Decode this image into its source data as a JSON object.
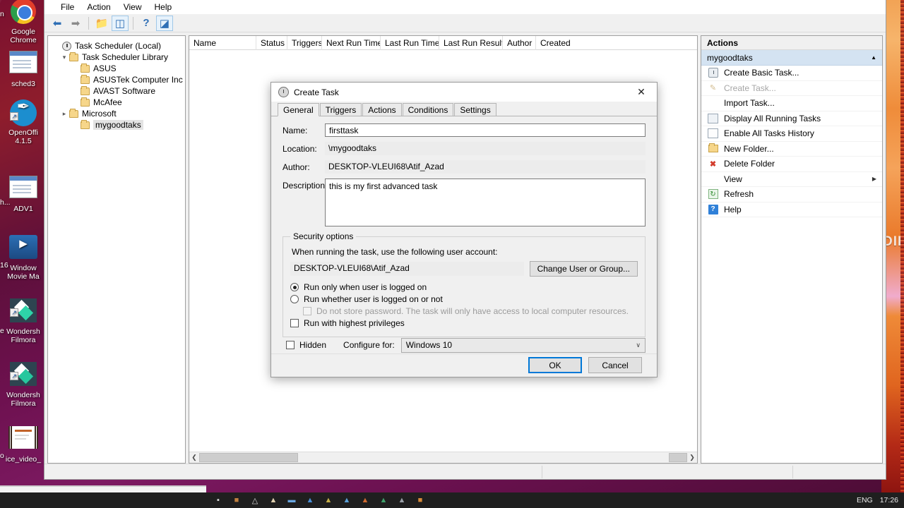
{
  "desktop": {
    "icons": [
      {
        "name": "Google\nChrome",
        "kind": "chrome"
      },
      {
        "name": "sched3",
        "kind": "window"
      },
      {
        "name": "OpenOffi\n4.1.5",
        "kind": "openoffice"
      },
      {
        "name": "ADV1",
        "kind": "window"
      },
      {
        "name": "Window\nMovie Ma",
        "kind": "moviemaker"
      },
      {
        "name": "Wondersh\nFilmora",
        "kind": "filmora"
      },
      {
        "name": "Wondersh\nFilmora",
        "kind": "filmora2"
      },
      {
        "name": "ice_video_",
        "kind": "film"
      }
    ],
    "clipped_labels": [
      "n",
      "16",
      "h...",
      "e",
      "o"
    ],
    "wallpaper_word": "DIE"
  },
  "window": {
    "menubar": [
      "File",
      "Action",
      "View",
      "Help"
    ],
    "toolbar_icons": [
      "back-arrow-icon",
      "forward-arrow-icon",
      "up-folder-icon",
      "show-hide-tree-icon",
      "help-icon",
      "show-action-pane-icon"
    ]
  },
  "tree": {
    "root": "Task Scheduler (Local)",
    "library": "Task Scheduler Library",
    "items": [
      {
        "label": "ASUS",
        "expandable": false,
        "selected": false
      },
      {
        "label": "ASUSTek Computer Inc",
        "expandable": false,
        "selected": false
      },
      {
        "label": "AVAST Software",
        "expandable": false,
        "selected": false
      },
      {
        "label": "McAfee",
        "expandable": false,
        "selected": false
      },
      {
        "label": "Microsoft",
        "expandable": true,
        "selected": false
      },
      {
        "label": "mygoodtaks",
        "expandable": false,
        "selected": true
      }
    ]
  },
  "list": {
    "columns": [
      "Name",
      "Status",
      "Triggers",
      "Next Run Time",
      "Last Run Time",
      "Last Run Result",
      "Author",
      "Created"
    ],
    "rows": []
  },
  "actions": {
    "header": "Actions",
    "group": "mygoodtaks",
    "items": [
      {
        "label": "Create Basic Task...",
        "icon": "create-basic-task-icon",
        "disabled": false
      },
      {
        "label": "Create Task...",
        "icon": "create-task-icon",
        "disabled": true
      },
      {
        "label": "Import Task...",
        "icon": "none",
        "disabled": false
      },
      {
        "label": "Display All Running Tasks",
        "icon": "running-tasks-icon",
        "disabled": false
      },
      {
        "label": "Enable All Tasks History",
        "icon": "history-icon",
        "disabled": false
      },
      {
        "label": "New Folder...",
        "icon": "new-folder-icon",
        "disabled": false
      },
      {
        "label": "Delete Folder",
        "icon": "delete-icon",
        "disabled": false
      },
      {
        "label": "View",
        "icon": "none",
        "disabled": false,
        "submenu": true
      },
      {
        "label": "Refresh",
        "icon": "refresh-icon",
        "disabled": false
      },
      {
        "label": "Help",
        "icon": "help-icon",
        "disabled": false
      }
    ]
  },
  "dialog": {
    "title": "Create Task",
    "close_label": "✕",
    "tabs": [
      {
        "label": "General",
        "active": true
      },
      {
        "label": "Triggers",
        "active": false
      },
      {
        "label": "Actions",
        "active": false
      },
      {
        "label": "Conditions",
        "active": false
      },
      {
        "label": "Settings",
        "active": false
      }
    ],
    "fields": {
      "name_label": "Name:",
      "name_value": "firsttask",
      "location_label": "Location:",
      "location_value": "\\mygoodtaks",
      "author_label": "Author:",
      "author_value": "DESKTOP-VLEUI68\\Atif_Azad",
      "description_label": "Description:",
      "description_value": "this is my first advanced task"
    },
    "security": {
      "legend": "Security options",
      "intro": "When running the task, use the following user account:",
      "account": "DESKTOP-VLEUI68\\Atif_Azad",
      "change_button": "Change User or Group...",
      "radio_logged_on": "Run only when user is logged on",
      "radio_logged_on_selected": true,
      "radio_whether": "Run whether user is logged on or not",
      "radio_whether_selected": false,
      "checkbox_no_password": "Do not store password.  The task will only have access to local computer resources.",
      "checkbox_no_password_checked": false,
      "checkbox_highest": "Run with highest privileges",
      "checkbox_highest_checked": false
    },
    "bottom": {
      "hidden_label": "Hidden",
      "hidden_checked": false,
      "configure_label": "Configure for:",
      "configure_value": "Windows 10",
      "chevron": "∨"
    },
    "footer": {
      "ok": "OK",
      "cancel": "Cancel"
    }
  },
  "taskbar": {
    "language": "ENG",
    "time": "17:26"
  },
  "colors": {
    "accent": "#0078d7",
    "group_header": "#d4e3f2",
    "delete_red": "#d23c2c",
    "desktop": "#6a0f38"
  }
}
